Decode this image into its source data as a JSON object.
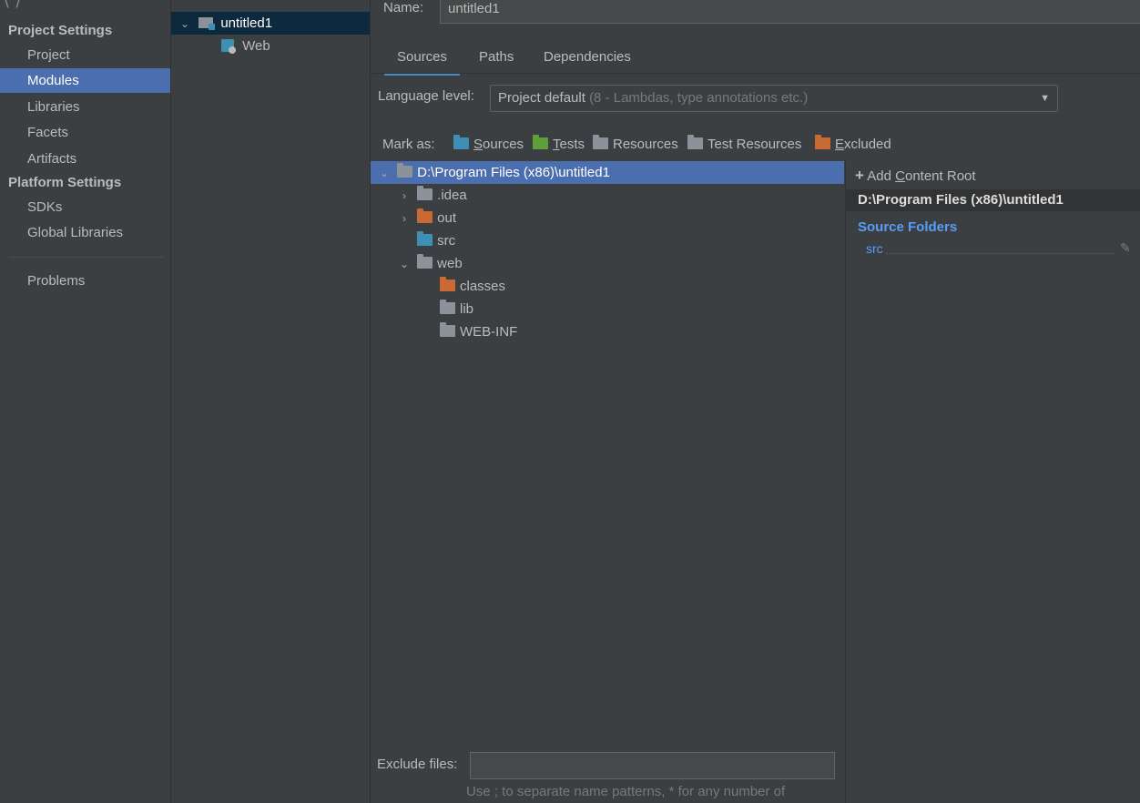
{
  "sidebar": {
    "project_settings_header": "Project Settings",
    "platform_settings_header": "Platform Settings",
    "items": [
      {
        "label": "Project"
      },
      {
        "label": "Modules"
      },
      {
        "label": "Libraries"
      },
      {
        "label": "Facets"
      },
      {
        "label": "Artifacts"
      },
      {
        "label": "SDKs"
      },
      {
        "label": "Global Libraries"
      },
      {
        "label": "Problems"
      }
    ],
    "selected": "Modules"
  },
  "module_tree": {
    "items": [
      {
        "label": "untitled1",
        "expanded": true,
        "selected": true
      },
      {
        "label": "Web"
      }
    ]
  },
  "module": {
    "name_label": "Name:",
    "name_value": "untitled1",
    "tabs": [
      {
        "label": "Sources",
        "active": true
      },
      {
        "label": "Paths"
      },
      {
        "label": "Dependencies"
      }
    ],
    "language_level_label": "Language level:",
    "language_level_value": "Project default",
    "language_level_detail": "(8 - Lambdas, type annotations etc.)",
    "mark_as_label": "Mark as:",
    "mark_as": [
      {
        "first": "S",
        "rest": "ources",
        "color": "#3d8fb5"
      },
      {
        "first": "T",
        "rest": "ests",
        "color": "#5e9f3b"
      },
      {
        "first": "",
        "rest": "Resources",
        "color": "#8c9299"
      },
      {
        "first": "",
        "rest": "Test Resources",
        "color": "#8c9299"
      },
      {
        "first": "E",
        "rest": "xcluded",
        "color": "#c96a32"
      }
    ]
  },
  "content_tree": [
    {
      "label": "D:\\Program Files (x86)\\untitled1",
      "selected": true
    },
    {
      "label": ".idea"
    },
    {
      "label": "out"
    },
    {
      "label": "src"
    },
    {
      "label": "web"
    },
    {
      "label": "classes"
    },
    {
      "label": "lib"
    },
    {
      "label": "WEB-INF"
    }
  ],
  "content_roots": {
    "add_label_prefix": "Add ",
    "add_label_underlined": "C",
    "add_label_suffix": "ontent Root",
    "root_path": "D:\\Program Files (x86)\\untitled1",
    "source_folders_header": "Source Folders",
    "source_folders": [
      "src"
    ]
  },
  "exclude": {
    "label": "Exclude files:",
    "value": "",
    "hint": "Use ; to separate name patterns, * for any number of"
  }
}
